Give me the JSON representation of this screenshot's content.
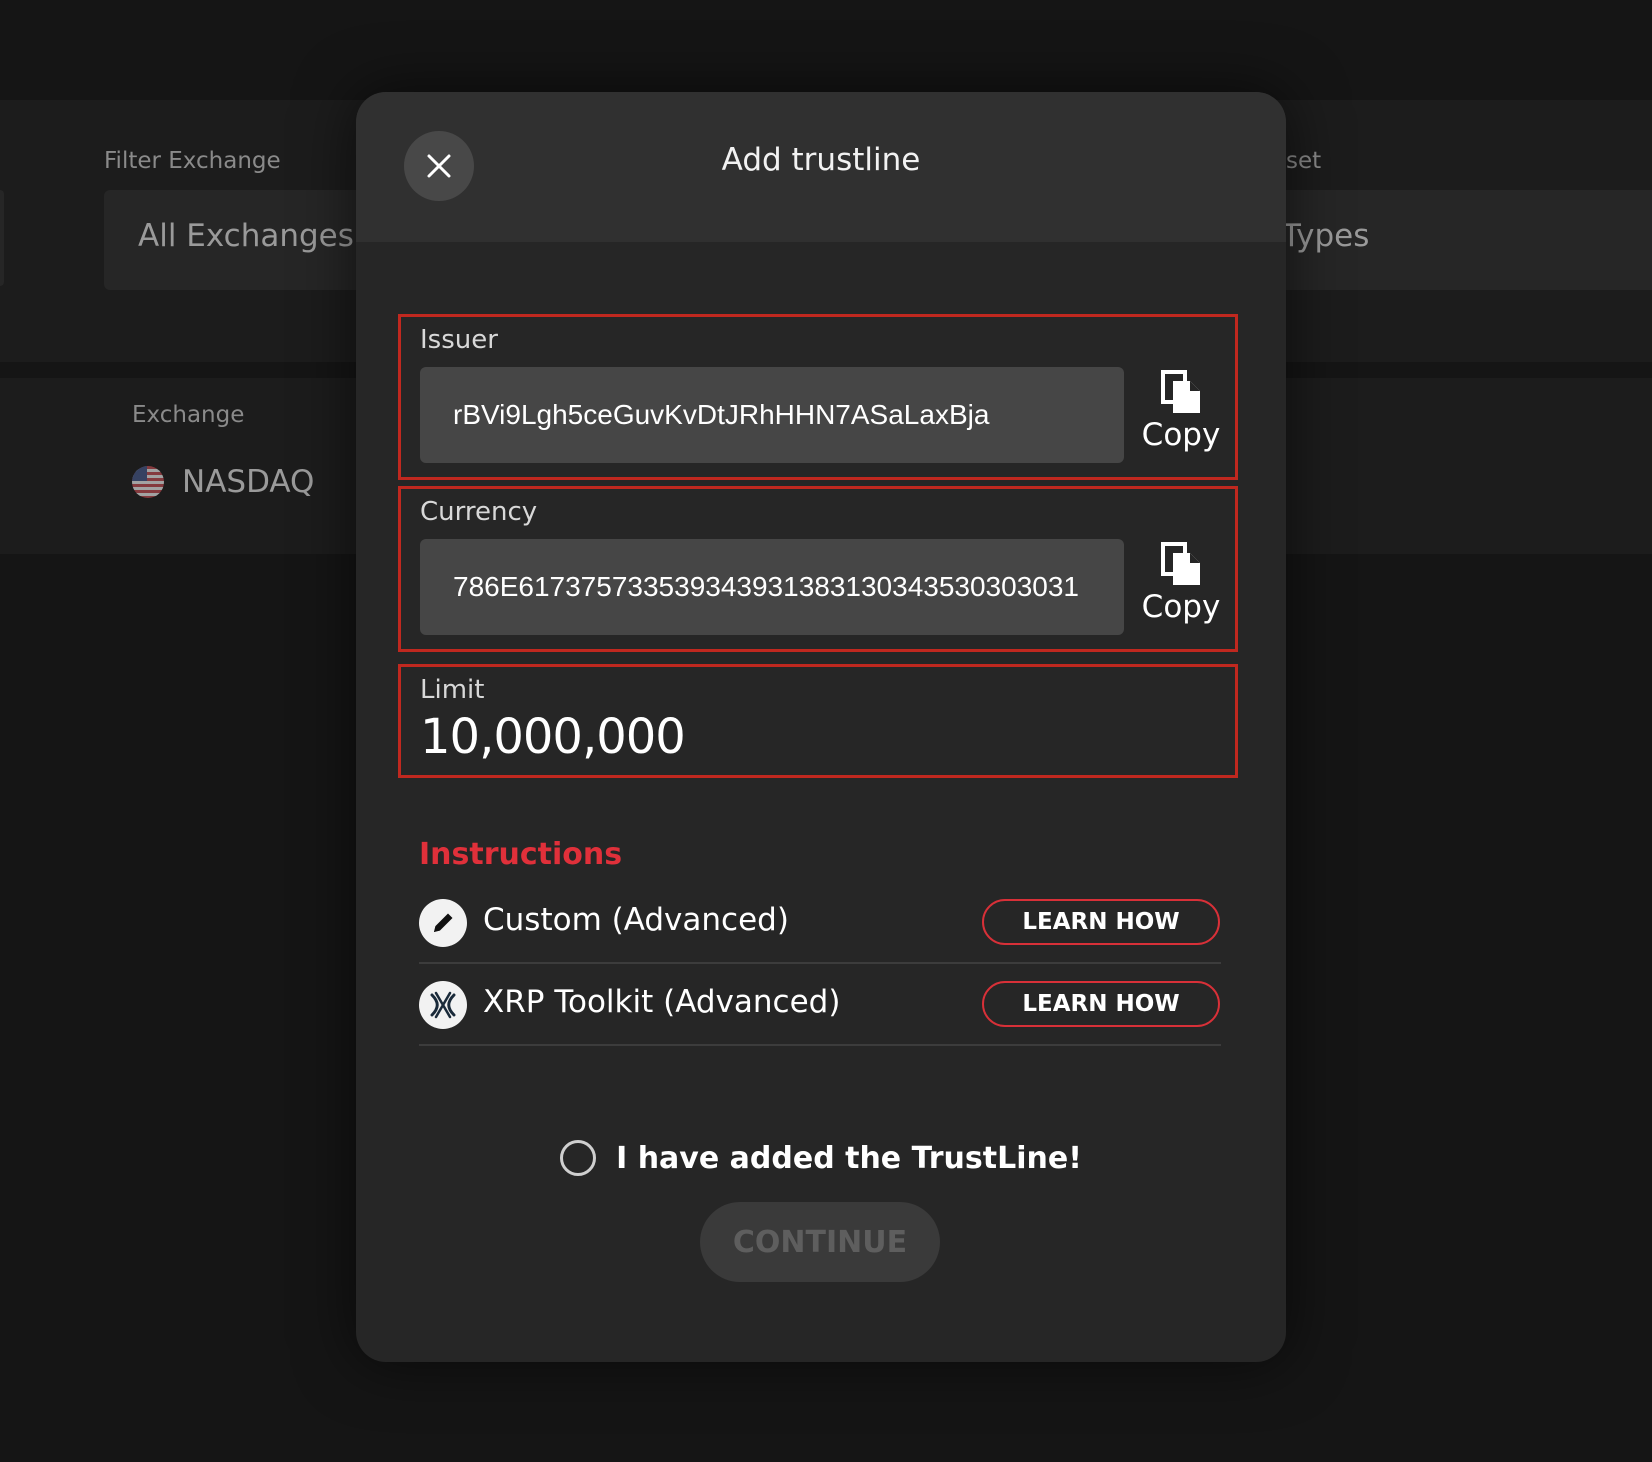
{
  "background": {
    "filter_exchange": {
      "label": "Filter Exchange",
      "value": "All Exchanges"
    },
    "filter_asset": {
      "label_fragment": "set",
      "value_fragment": "Types"
    },
    "table": {
      "column_exchange": "Exchange",
      "row_exchange": "NASDAQ"
    }
  },
  "modal": {
    "title": "Add trustline",
    "issuer": {
      "label": "Issuer",
      "value": "rBVi9Lgh5ceGuvKvDtJRhHHN7ASaLaxBja",
      "copy_label": "Copy"
    },
    "currency": {
      "label": "Currency",
      "value": "786E617375733539343931383130343530303031",
      "copy_label": "Copy"
    },
    "limit": {
      "label": "Limit",
      "value": "10,000,000"
    },
    "instructions": {
      "title": "Instructions",
      "items": [
        {
          "label": "Custom (Advanced)",
          "button": "LEARN HOW",
          "icon": "pencil-icon"
        },
        {
          "label": "XRP Toolkit (Advanced)",
          "button": "LEARN HOW",
          "icon": "xrp-toolkit-icon"
        }
      ]
    },
    "confirm_label": "I have added the TrustLine!",
    "continue_label": "CONTINUE"
  },
  "colors": {
    "accent": "#e0303a",
    "highlight_border": "#c0281f",
    "modal_bg": "#262626",
    "backdrop": "#151515"
  }
}
